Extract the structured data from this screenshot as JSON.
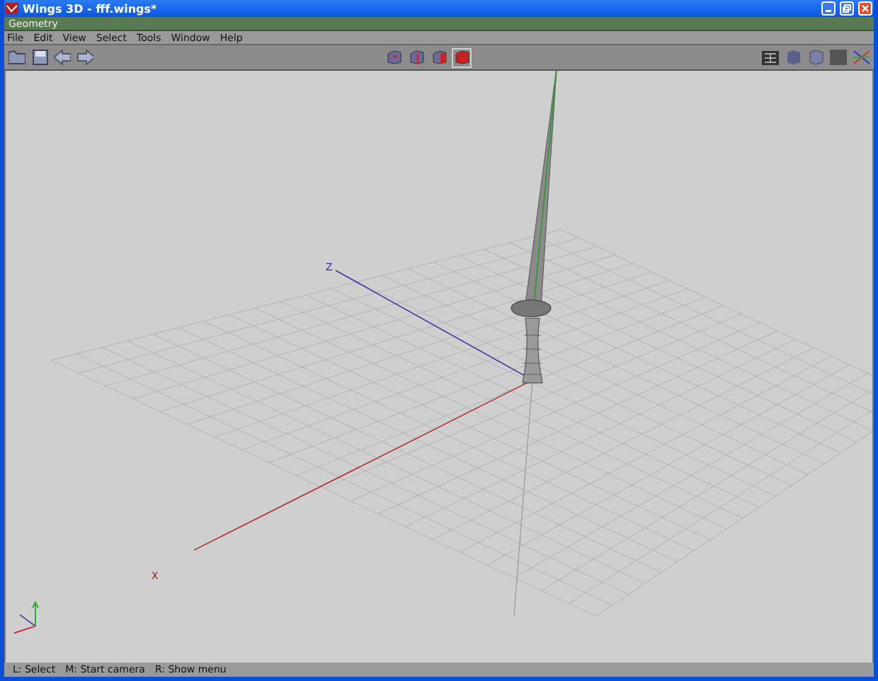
{
  "window": {
    "title": "Wings 3D - fff.wings*"
  },
  "geometry_bar": {
    "title": "Geometry"
  },
  "menu": [
    "File",
    "Edit",
    "View",
    "Select",
    "Tools",
    "Window",
    "Help"
  ],
  "select_modes": [
    {
      "kind": "vertex",
      "selected": false
    },
    {
      "kind": "edge",
      "selected": false
    },
    {
      "kind": "face",
      "selected": false
    },
    {
      "kind": "body",
      "selected": true
    }
  ],
  "viewport": {
    "axis_labels": [
      {
        "kind": "z",
        "text": "Z"
      },
      {
        "kind": "x",
        "text": "X"
      }
    ]
  },
  "status_bar": [
    "L: Select",
    "M: Start camera",
    "R: Show menu"
  ]
}
